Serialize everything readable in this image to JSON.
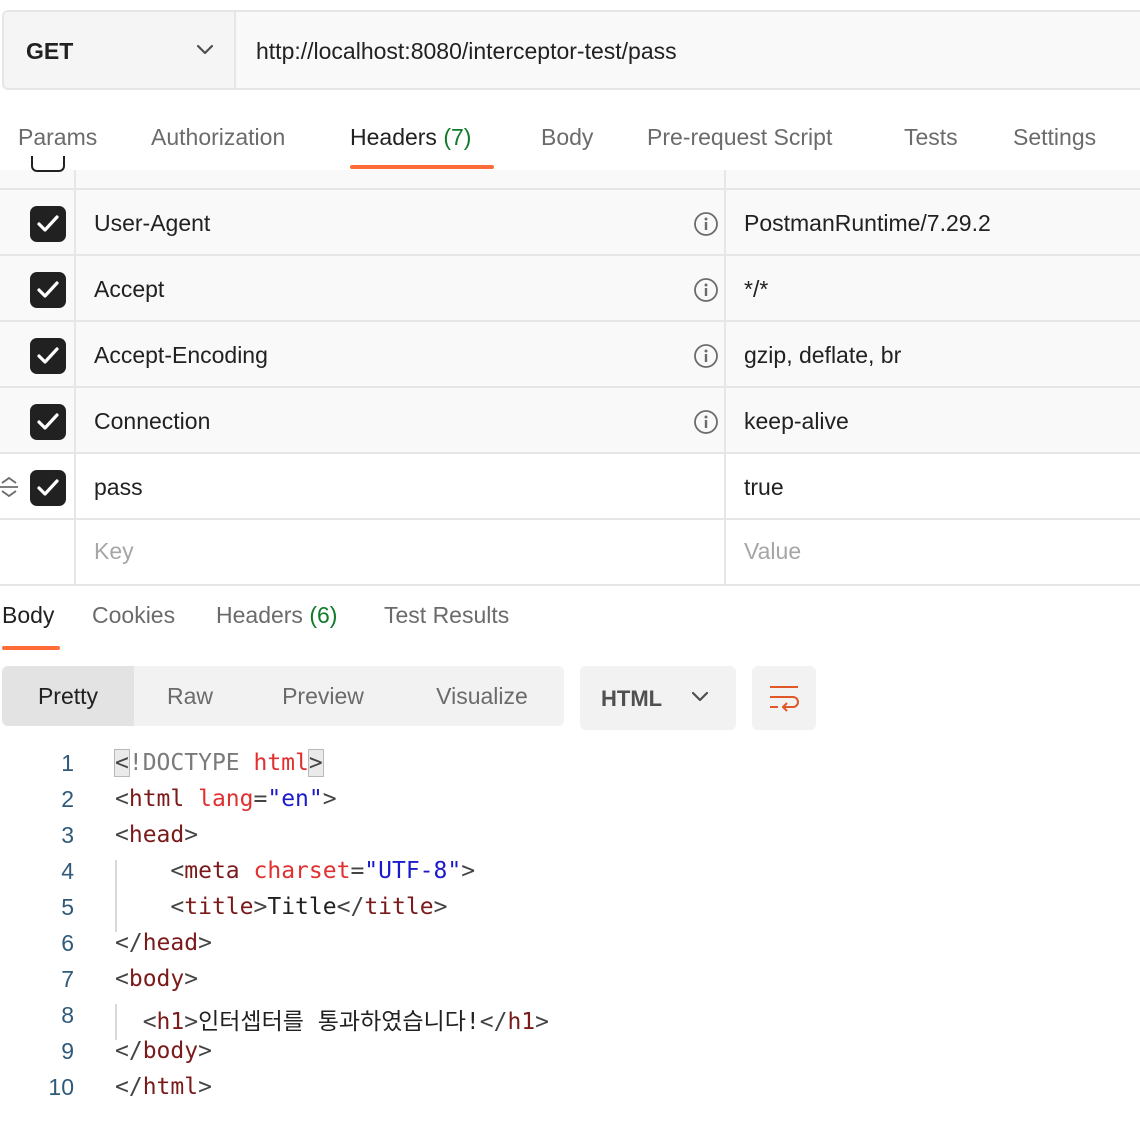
{
  "request": {
    "method": "GET",
    "url": "http://localhost:8080/interceptor-test/pass"
  },
  "request_tabs": [
    {
      "label": "Params",
      "count": ""
    },
    {
      "label": "Authorization",
      "count": ""
    },
    {
      "label": "Headers",
      "count": "(7)"
    },
    {
      "label": "Body",
      "count": ""
    },
    {
      "label": "Pre-request Script",
      "count": ""
    },
    {
      "label": "Tests",
      "count": ""
    },
    {
      "label": "Settings",
      "count": ""
    }
  ],
  "headers": [
    {
      "key": "User-Agent",
      "value": "PostmanRuntime/7.29.2",
      "checked": true,
      "auto": true
    },
    {
      "key": "Accept",
      "value": "*/*",
      "checked": true,
      "auto": true
    },
    {
      "key": "Accept-Encoding",
      "value": "gzip, deflate, br",
      "checked": true,
      "auto": true
    },
    {
      "key": "Connection",
      "value": "keep-alive",
      "checked": true,
      "auto": true
    },
    {
      "key": "pass",
      "value": "true",
      "checked": true,
      "auto": false
    }
  ],
  "new_header": {
    "key_placeholder": "Key",
    "value_placeholder": "Value"
  },
  "response_tabs": [
    {
      "label": "Body",
      "count": ""
    },
    {
      "label": "Cookies",
      "count": ""
    },
    {
      "label": "Headers",
      "count": "(6)"
    },
    {
      "label": "Test Results",
      "count": ""
    }
  ],
  "view_modes": [
    "Pretty",
    "Raw",
    "Preview",
    "Visualize"
  ],
  "format": "HTML",
  "code_lines": [
    {
      "n": "1",
      "parts": [
        [
          "&lt;",
          "pun"
        ],
        [
          "!DOCTYPE ",
          "doc"
        ],
        [
          "html",
          "attr"
        ],
        [
          "&gt;",
          "pun"
        ]
      ]
    },
    {
      "n": "2",
      "parts": [
        [
          "<",
          "pun"
        ],
        [
          "html",
          "tag"
        ],
        [
          " ",
          "text"
        ],
        [
          "lang",
          "attr"
        ],
        [
          "=",
          "pun"
        ],
        [
          "\"en\"",
          "str"
        ],
        [
          ">",
          "pun"
        ]
      ]
    },
    {
      "n": "3",
      "parts": [
        [
          "<",
          "pun"
        ],
        [
          "head",
          "tag"
        ],
        [
          ">",
          "pun"
        ]
      ]
    },
    {
      "n": "4",
      "parts": [
        [
          "    <",
          "pun"
        ],
        [
          "meta",
          "tag"
        ],
        [
          " ",
          "text"
        ],
        [
          "charset",
          "attr"
        ],
        [
          "=",
          "pun"
        ],
        [
          "\"UTF-8\"",
          "str"
        ],
        [
          ">",
          "pun"
        ]
      ]
    },
    {
      "n": "5",
      "parts": [
        [
          "    <",
          "pun"
        ],
        [
          "title",
          "tag"
        ],
        [
          ">",
          "pun"
        ],
        [
          "Title",
          "text"
        ],
        [
          "</",
          "pun"
        ],
        [
          "title",
          "tag"
        ],
        [
          ">",
          "pun"
        ]
      ]
    },
    {
      "n": "6",
      "parts": [
        [
          "</",
          "pun"
        ],
        [
          "head",
          "tag"
        ],
        [
          ">",
          "pun"
        ]
      ]
    },
    {
      "n": "7",
      "parts": [
        [
          "<",
          "pun"
        ],
        [
          "body",
          "tag"
        ],
        [
          ">",
          "pun"
        ]
      ]
    },
    {
      "n": "8",
      "parts": [
        [
          "  <",
          "pun"
        ],
        [
          "h1",
          "tag"
        ],
        [
          ">",
          "pun"
        ],
        [
          "인터셉터를 통과하였습니다!",
          "text"
        ],
        [
          "</",
          "pun"
        ],
        [
          "h1",
          "tag"
        ],
        [
          ">",
          "pun"
        ]
      ]
    },
    {
      "n": "9",
      "parts": [
        [
          "</",
          "pun"
        ],
        [
          "body",
          "tag"
        ],
        [
          ">",
          "pun"
        ]
      ]
    },
    {
      "n": "10",
      "parts": [
        [
          "</",
          "pun"
        ],
        [
          "html",
          "tag"
        ],
        [
          ">",
          "pun"
        ]
      ]
    }
  ],
  "colors": {
    "accent": "#ff6c37",
    "count": "#0f7b2a"
  }
}
